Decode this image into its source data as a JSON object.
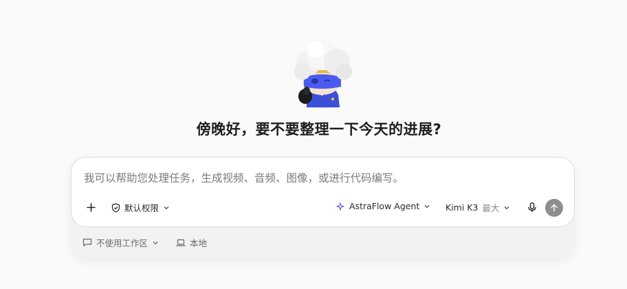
{
  "greeting": "傍晚好，要不要整理一下今天的进展?",
  "composer": {
    "placeholder": "我可以帮助您处理任务，生成视频、音频、图像，或进行代码编写。",
    "permission_label": "默认权限",
    "agent_label": "AstraFlow Agent",
    "model_name": "Kimi K3",
    "model_mode": "最大"
  },
  "footer": {
    "workspace_label": "不使用工作区",
    "location_label": "本地"
  },
  "colors": {
    "send_button": "#8e8e8e",
    "agent_icon": "#5b5ce6",
    "mascot_blue": "#3b4fd8"
  },
  "icons": [
    "mascot-illustration",
    "plus-icon",
    "shield-check-icon",
    "chevron-down-icon",
    "sparkle-agent-icon",
    "microphone-icon",
    "arrow-up-icon",
    "chat-bubble-icon",
    "laptop-icon"
  ]
}
